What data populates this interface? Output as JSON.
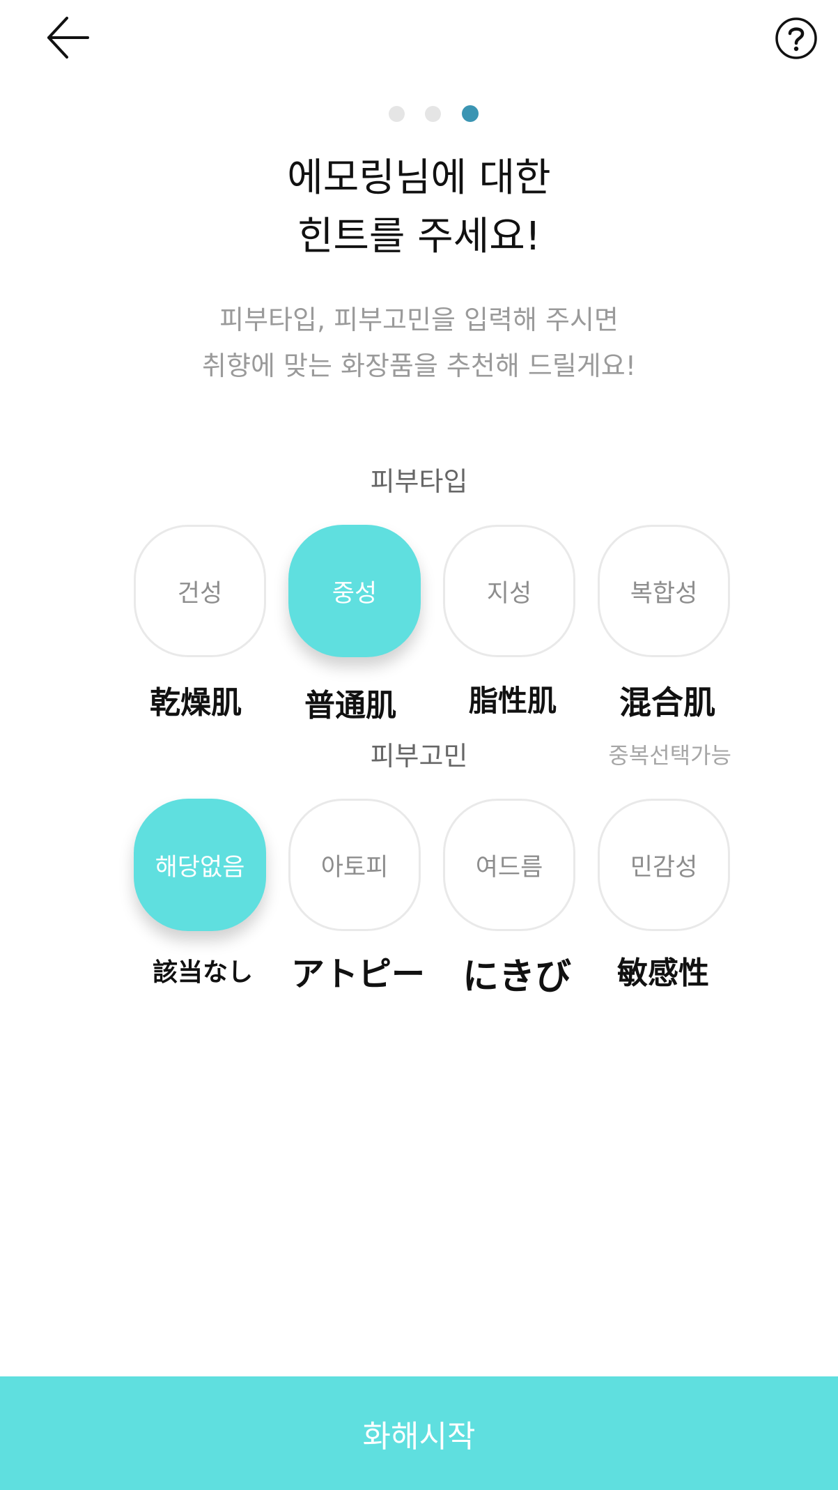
{
  "header": {
    "back_icon": "arrow-left-icon",
    "help_icon": "question-circle-icon"
  },
  "progress": {
    "total_steps": 3,
    "current_step": 3,
    "active_color": "#3b95b3"
  },
  "title": {
    "line1": "에모링님에 대한",
    "line2": "힌트를 주세요!"
  },
  "subtitle": {
    "line1": "피부타입, 피부고민을 입력해 주시면",
    "line2": "취향에 맞는 화장품을 추천해 드릴게요!"
  },
  "skin_type": {
    "label": "피부타입",
    "options": [
      {
        "label": "건성",
        "annotation": "乾燥肌",
        "selected": false
      },
      {
        "label": "중성",
        "annotation": "普通肌",
        "selected": true
      },
      {
        "label": "지성",
        "annotation": "脂性肌",
        "selected": false
      },
      {
        "label": "복합성",
        "annotation": "混合肌",
        "selected": false
      }
    ]
  },
  "skin_concern": {
    "label": "피부고민",
    "multi_select_note": "중복선택가능",
    "options": [
      {
        "label": "해당없음",
        "annotation": "該当なし",
        "selected": true
      },
      {
        "label": "아토피",
        "annotation": "アトピー",
        "selected": false
      },
      {
        "label": "여드름",
        "annotation": "にきび",
        "selected": false
      },
      {
        "label": "민감성",
        "annotation": "敏感性",
        "selected": false
      }
    ]
  },
  "cta": {
    "label": "화해시작"
  },
  "colors": {
    "accent": "#5fdfdf",
    "border": "#e9e9e9",
    "muted_text": "#9a9a9a"
  }
}
